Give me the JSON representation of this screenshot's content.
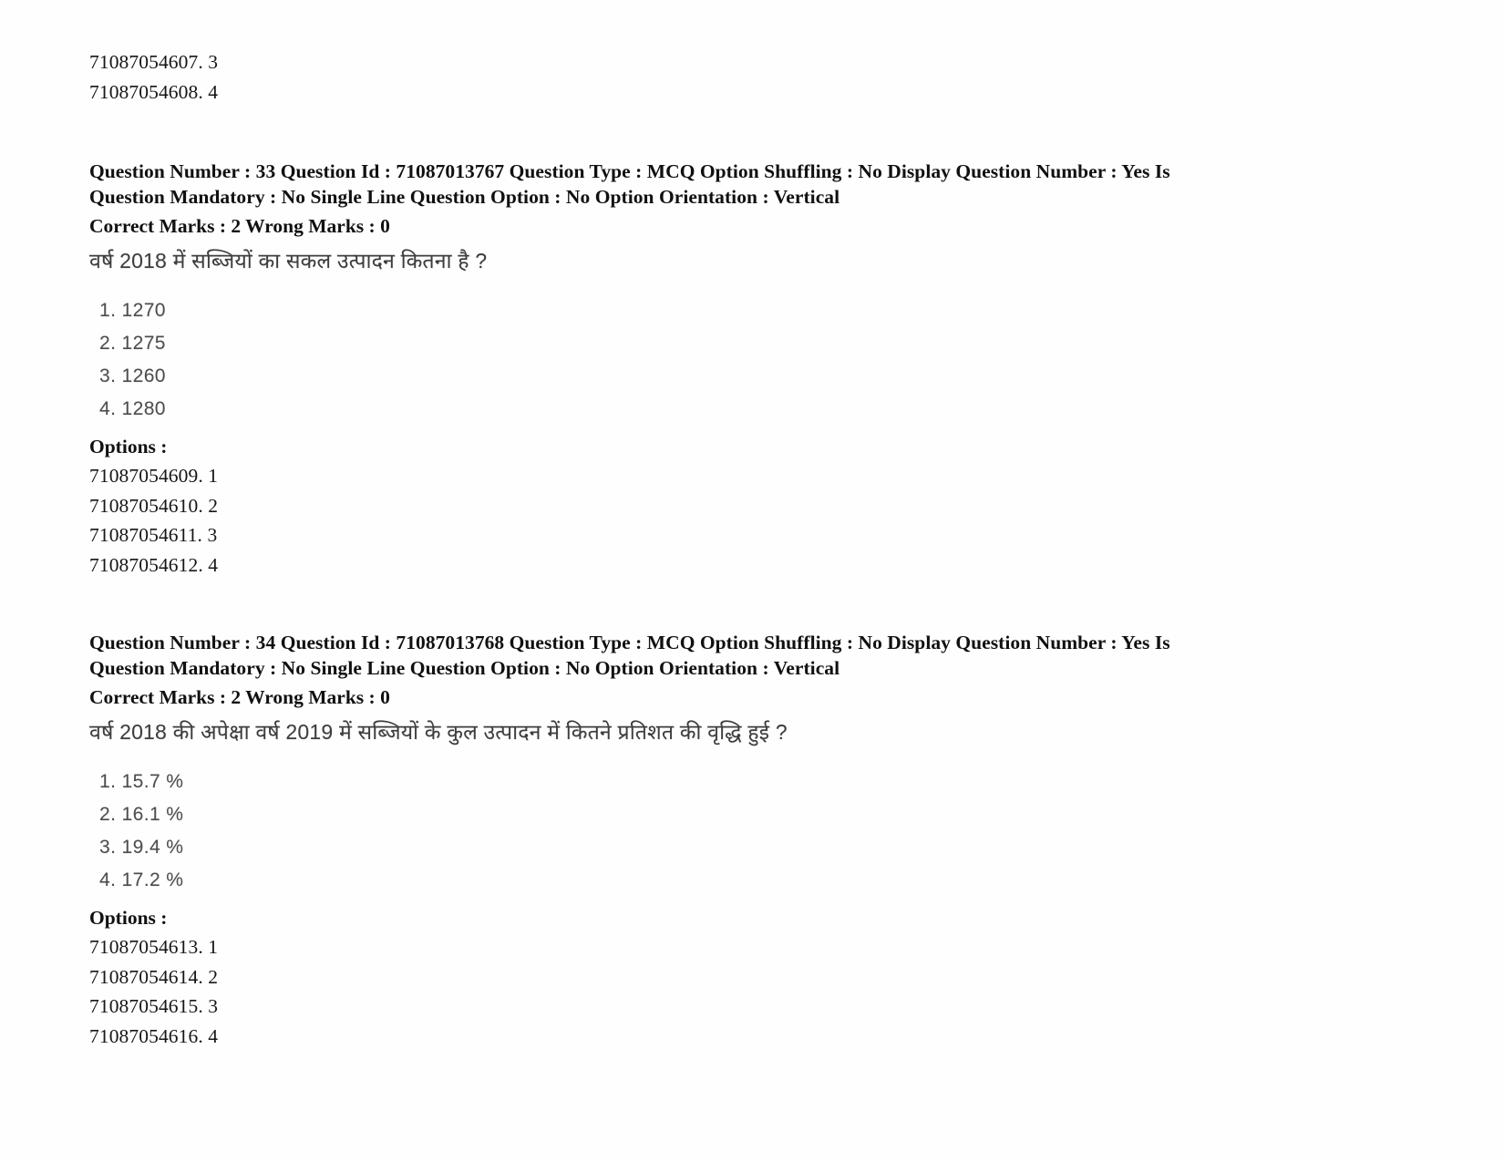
{
  "document": {
    "type": "scanned-question-paper",
    "background_color": "#fefefe",
    "text_color": "#161616",
    "scan_text_color": "#4a4a4a"
  },
  "top_option_ids": [
    "71087054607. 3",
    "71087054608. 4"
  ],
  "questions": [
    {
      "meta_line_1": "Question Number : 33 Question Id : 71087013767 Question Type : MCQ Option Shuffling : No Display Question Number : Yes Is",
      "meta_line_2": "Question Mandatory : No Single Line Question Option : No Option Orientation : Vertical",
      "marks_line": "Correct Marks : 2 Wrong Marks : 0",
      "question_number": "33",
      "question_id": "71087013767",
      "question_type": "MCQ",
      "option_shuffling": "No",
      "display_question_number": "Yes",
      "is_question_mandatory": "No",
      "single_line_question_option": "No",
      "option_orientation": "Vertical",
      "correct_marks": "2",
      "wrong_marks": "0",
      "question_text": "वर्ष 2018 में सब्जियों का सकल उत्पादन कितना है ?",
      "choices": [
        "1. 1270",
        "2. 1275",
        "3. 1260",
        "4. 1280"
      ],
      "options_label": "Options :",
      "option_ids": [
        "71087054609. 1",
        "71087054610. 2",
        "71087054611. 3",
        "71087054612. 4"
      ]
    },
    {
      "meta_line_1": "Question Number : 34 Question Id : 71087013768 Question Type : MCQ Option Shuffling : No Display Question Number : Yes Is",
      "meta_line_2": "Question Mandatory : No Single Line Question Option : No Option Orientation : Vertical",
      "marks_line": "Correct Marks : 2 Wrong Marks : 0",
      "question_number": "34",
      "question_id": "71087013768",
      "question_type": "MCQ",
      "option_shuffling": "No",
      "display_question_number": "Yes",
      "is_question_mandatory": "No",
      "single_line_question_option": "No",
      "option_orientation": "Vertical",
      "correct_marks": "2",
      "wrong_marks": "0",
      "question_text": "वर्ष 2018 की अपेक्षा वर्ष 2019 में सब्जियों के कुल उत्पादन में कितने प्रतिशत की वृद्धि हुई ?",
      "choices": [
        "1. 15.7 %",
        "2. 16.1 %",
        "3. 19.4 %",
        "4. 17.2 %"
      ],
      "options_label": "Options :",
      "option_ids": [
        "71087054613. 1",
        "71087054614. 2",
        "71087054615. 3",
        "71087054616. 4"
      ]
    }
  ]
}
